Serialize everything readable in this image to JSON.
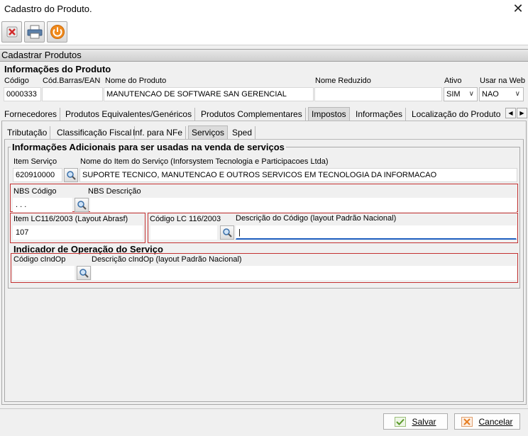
{
  "window": {
    "title": "Cadastro do Produto."
  },
  "section": {
    "title": "Cadastrar Produtos"
  },
  "produto": {
    "group_title": "Informações do Produto",
    "codigo_label": "Código",
    "codigo_value": "0000333",
    "barras_label": "Cód.Barras/EAN",
    "barras_value": "",
    "nome_label": "Nome do Produto",
    "nome_value": "MANUTENCAO DE SOFTWARE SAN GERENCIAL",
    "reduzido_label": "Nome Reduzido",
    "reduzido_value": "",
    "ativo_label": "Ativo",
    "ativo_value": "SIM",
    "web_label": "Usar na Web",
    "web_value": "NAO"
  },
  "main_tabs": [
    "Fornecedores",
    "Produtos Equivalentes/Genéricos",
    "Produtos Complementares",
    "Impostos",
    "Informações",
    "Localização do Produto"
  ],
  "sub_tabs": [
    "Tributação",
    "Classificação Fiscal",
    "Inf. para NFe",
    "Serviços",
    "Sped"
  ],
  "servicos": {
    "group_title": "Informações Adicionais para ser usadas na venda de serviços",
    "item_label": "Item Serviço",
    "item_value": "620910000",
    "nome_item_label": "Nome do Item do Serviço (Inforsystem Tecnologia e Participacoes Ltda)",
    "nome_item_value": "SUPORTE TECNICO, MANUTENCAO E OUTROS SERVICOS EM TECNOLOGIA DA INFORMACAO",
    "nbs_codigo_label": "NBS Código",
    "nbs_codigo_value": ". . .",
    "nbs_desc_label": "NBS Descrição",
    "nbs_desc_value": "",
    "lc_abrasf_label": "Item LC116/2003 (Layout Abrasf)",
    "lc_abrasf_value": "107",
    "cod_lc_label": "Código LC 116/2003",
    "cod_lc_value": "",
    "desc_codigo_label": "Descrição do Código (layout Padrão Nacional)",
    "desc_codigo_value": "|"
  },
  "indicador": {
    "group_title": "Indicador de Operação do Serviço",
    "cod_label": "Código cIndOp",
    "cod_value": "",
    "desc_label": "Descrição cIndOp (layout Padrão Nacional)",
    "desc_value": ""
  },
  "footer": {
    "salvar": "Salvar",
    "cancelar": "Cancelar"
  },
  "colors": {
    "border_red": "#c43131",
    "focus_blue": "#1f5fbf",
    "accent_orange": "#e67e22"
  }
}
